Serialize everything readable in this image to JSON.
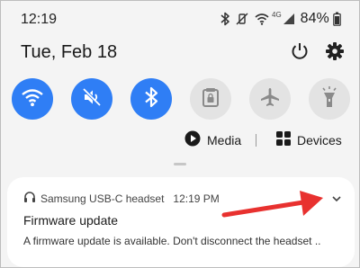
{
  "status_bar": {
    "time": "12:19",
    "network_type": "4G",
    "battery_percent": "84%",
    "icons": [
      "bluetooth-icon",
      "vibrate-icon",
      "wifi-icon",
      "signal-icon",
      "battery-icon"
    ]
  },
  "header": {
    "date": "Tue, Feb 18",
    "icons": [
      "power-icon",
      "gear-icon"
    ]
  },
  "quick_tiles": [
    {
      "name": "wifi",
      "icon": "wifi-icon",
      "state": "on"
    },
    {
      "name": "sound",
      "icon": "mute-icon",
      "state": "on"
    },
    {
      "name": "bluetooth",
      "icon": "bluetooth-icon",
      "state": "on"
    },
    {
      "name": "secure-folder",
      "icon": "lock-folder-icon",
      "state": "off"
    },
    {
      "name": "airplane-mode",
      "icon": "airplane-icon",
      "state": "off"
    },
    {
      "name": "flashlight",
      "icon": "flashlight-icon",
      "state": "off"
    }
  ],
  "controls": {
    "media_label": "Media",
    "devices_label": "Devices"
  },
  "notification": {
    "app_name": "Samsung USB-C headset",
    "time": "12:19 PM",
    "title": "Firmware update",
    "body": "A firmware update is available. Don't disconnect the headset .."
  },
  "colors": {
    "tile_on": "#2f7ef5",
    "tile_off": "#e3e3e3",
    "panel_background": "#f4f4f4",
    "card_background": "#ffffff",
    "annotation_arrow": "#e8312f"
  }
}
